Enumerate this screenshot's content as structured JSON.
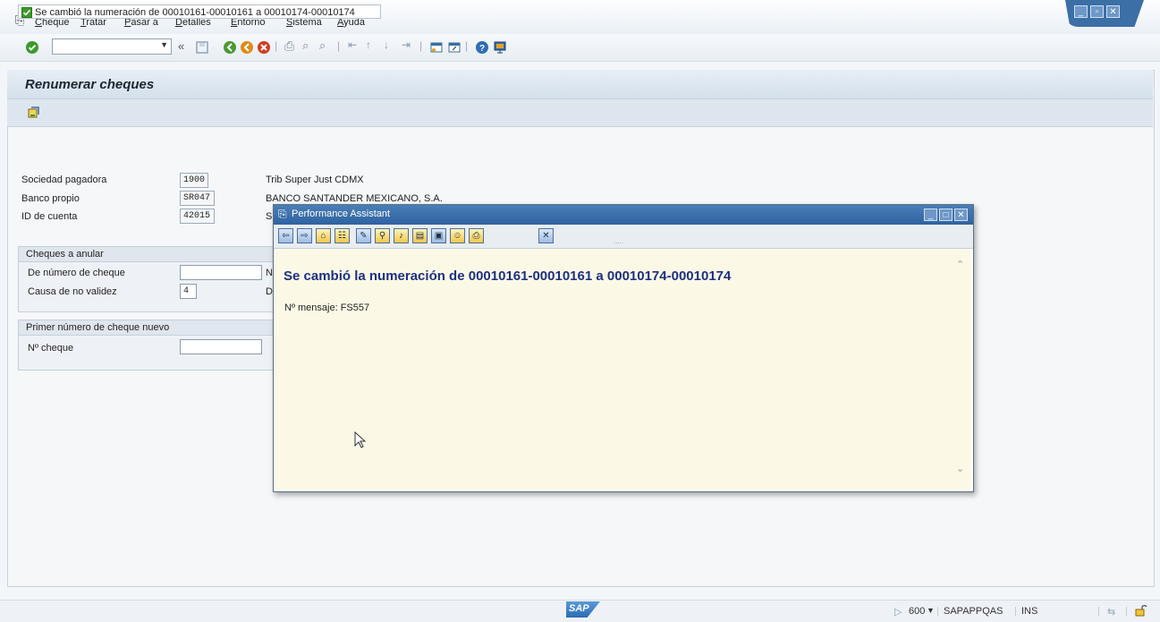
{
  "menu": {
    "items": [
      "Cheque",
      "Tratar",
      "Pasar a",
      "Detalles",
      "Entorno",
      "Sistema",
      "Ayuda"
    ]
  },
  "window_controls": {
    "minimize": "minimize-icon",
    "restore": "restore-icon",
    "close": "close-icon"
  },
  "toolbar": {
    "command_field_value": "",
    "icons": [
      "enter-icon",
      "back-arrows-icon",
      "save-icon",
      "back-icon",
      "exit-icon",
      "cancel-icon",
      "print-icon",
      "find-icon",
      "find-next-icon",
      "first-page-icon",
      "prev-page-icon",
      "next-page-icon",
      "last-page-icon",
      "new-session-icon",
      "shortcut-icon",
      "help-icon",
      "customize-icon"
    ]
  },
  "page": {
    "title": "Renumerar cheques",
    "app_toolbar_icon": "execute-icon"
  },
  "form": {
    "sociedad_label": "Sociedad pagadora",
    "sociedad_value": "1900",
    "sociedad_desc": "Trib Super Just CDMX",
    "banco_label": "Banco propio",
    "banco_value": "SR047",
    "banco_desc": "BANCO SANTANDER MEXICANO, S.A.",
    "cuenta_label": "ID de cuenta",
    "cuenta_value": "42015",
    "cuenta_desc_partial": "S",
    "anular_group": "Cheques a anular",
    "de_numero_label": "De número de cheque",
    "de_numero_value": "",
    "de_numero_trailing": "N",
    "causa_label": "Causa de no validez",
    "causa_value": "4",
    "causa_trailing": "D",
    "nuevo_group": "Primer número de cheque nuevo",
    "no_cheque_label": "Nº cheque",
    "no_cheque_value": ""
  },
  "dialog": {
    "title": "Performance Assistant",
    "message": "Se cambió la numeración de 00010161-00010161 a 00010174-00010174",
    "code": "Nº mensaje: FS557",
    "grip": "....."
  },
  "status": {
    "message": "Se cambió la numeración de 00010161-00010161 a 00010174-00010174",
    "logo": "SAP",
    "client": "600",
    "system": "SAPAPPQAS",
    "mode": "INS"
  },
  "colors": {
    "accent": "#2f62a0",
    "message_text": "#1d2f82",
    "dialog_body": "#fbf9e6",
    "success": "#3a9a2a"
  }
}
